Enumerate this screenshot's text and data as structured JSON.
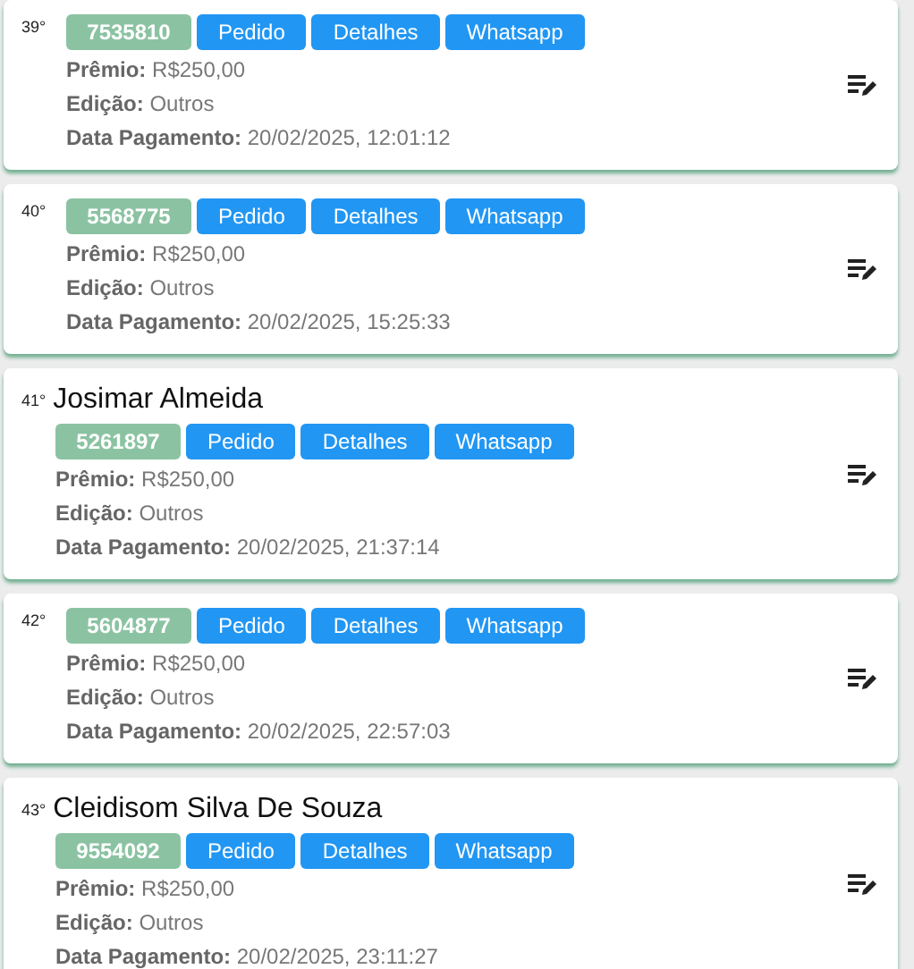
{
  "entries": [
    {
      "rank": "39°",
      "code": "7535810",
      "buttons": [
        "Pedido",
        "Detalhes",
        "Whatsapp"
      ],
      "fields": [
        {
          "label": "Prêmio:",
          "value": "R$250,00"
        },
        {
          "label": "Edição:",
          "value": "Outros"
        },
        {
          "label": "Data Pagamento:",
          "value": "20/02/2025, 12:01:12"
        }
      ]
    },
    {
      "rank": "40°",
      "code": "5568775",
      "buttons": [
        "Pedido",
        "Detalhes",
        "Whatsapp"
      ],
      "fields": [
        {
          "label": "Prêmio:",
          "value": "R$250,00"
        },
        {
          "label": "Edição:",
          "value": "Outros"
        },
        {
          "label": "Data Pagamento:",
          "value": "20/02/2025, 15:25:33"
        }
      ]
    },
    {
      "rank": "41°",
      "name": "Josimar Almeida",
      "code": "5261897",
      "buttons": [
        "Pedido",
        "Detalhes",
        "Whatsapp"
      ],
      "fields": [
        {
          "label": "Prêmio:",
          "value": "R$250,00"
        },
        {
          "label": "Edição:",
          "value": "Outros"
        },
        {
          "label": "Data Pagamento:",
          "value": "20/02/2025, 21:37:14"
        }
      ]
    },
    {
      "rank": "42°",
      "code": "5604877",
      "buttons": [
        "Pedido",
        "Detalhes",
        "Whatsapp"
      ],
      "fields": [
        {
          "label": "Prêmio:",
          "value": "R$250,00"
        },
        {
          "label": "Edição:",
          "value": "Outros"
        },
        {
          "label": "Data Pagamento:",
          "value": "20/02/2025, 22:57:03"
        }
      ]
    },
    {
      "rank": "43°",
      "name": "Cleidisom Silva De Souza",
      "code": "9554092",
      "buttons": [
        "Pedido",
        "Detalhes",
        "Whatsapp"
      ],
      "fields": [
        {
          "label": "Prêmio:",
          "value": "R$250,00"
        },
        {
          "label": "Edição:",
          "value": "Outros"
        },
        {
          "label": "Data Pagamento:",
          "value": "20/02/2025, 23:11:27"
        }
      ]
    }
  ]
}
